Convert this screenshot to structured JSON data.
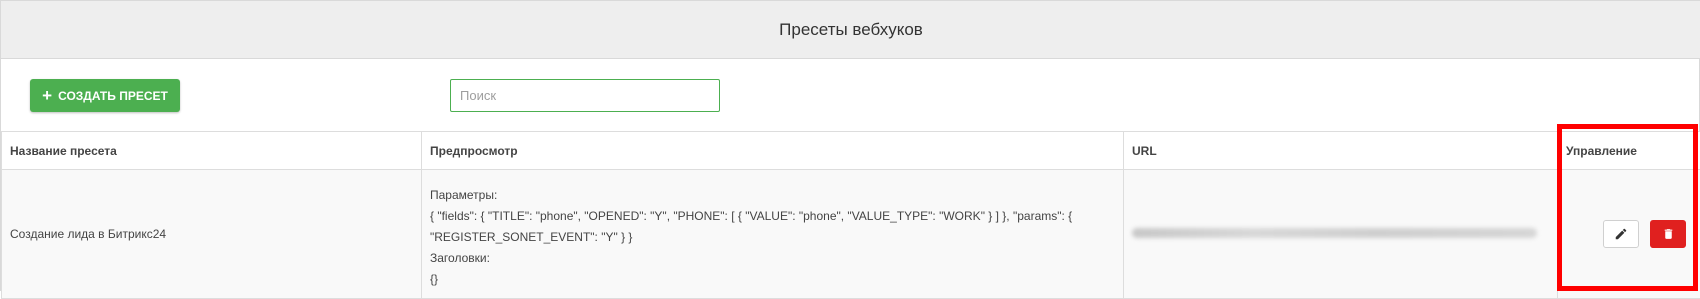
{
  "header": {
    "title": "Пресеты вебхуков"
  },
  "toolbar": {
    "create_label": "СОЗДАТЬ ПРЕСЕТ",
    "search_placeholder": "Поиск"
  },
  "table": {
    "columns": [
      "Название пресета",
      "Предпросмотр",
      "URL",
      "Управление"
    ],
    "rows": [
      {
        "name": "Создание лида в Битрикс24",
        "preview": [
          "Параметры:",
          "{ \"fields\": { \"TITLE\": \"phone\", \"OPENED\": \"Y\", \"PHONE\": [ { \"VALUE\": \"phone\", \"VALUE_TYPE\": \"WORK\" } ] }, \"params\": {",
          "\"REGISTER_SONET_EVENT\": \"Y\" } }",
          "Заголовки:",
          "{}"
        ]
      }
    ]
  },
  "icons": {
    "create": "plus-icon",
    "edit": "pencil-icon",
    "delete": "trash-icon"
  },
  "colors": {
    "primary": "#4caf50",
    "danger": "#e0201f",
    "highlight": "#ff0000",
    "header_bg": "#eeeeee"
  }
}
